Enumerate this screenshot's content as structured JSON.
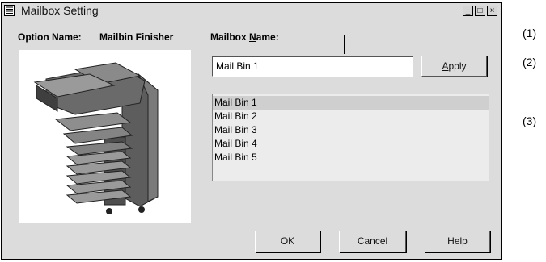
{
  "window": {
    "title": "Mailbox Setting",
    "controls": {
      "minimize": "_",
      "maximize": "□",
      "close": "×"
    }
  },
  "option": {
    "label": "Option Name:",
    "value": "Mailbin Finisher"
  },
  "mailbox_name": {
    "label_prefix": "Mailbox ",
    "label_mnemonic": "N",
    "label_suffix": "ame:",
    "input_value": "Mail Bin 1"
  },
  "apply_button": {
    "mnemonic": "A",
    "rest": "pply"
  },
  "mailbox_list": [
    {
      "label": "Mail Bin 1",
      "selected": true
    },
    {
      "label": "Mail Bin 2",
      "selected": false
    },
    {
      "label": "Mail Bin 3",
      "selected": false
    },
    {
      "label": "Mail Bin 4",
      "selected": false
    },
    {
      "label": "Mail Bin 5",
      "selected": false
    }
  ],
  "buttons": {
    "ok": "OK",
    "cancel": "Cancel",
    "help": "Help"
  },
  "callouts": [
    "(1)",
    "(2)",
    "(3)"
  ],
  "image": {
    "icon": "mailbin-finisher-illustration"
  }
}
